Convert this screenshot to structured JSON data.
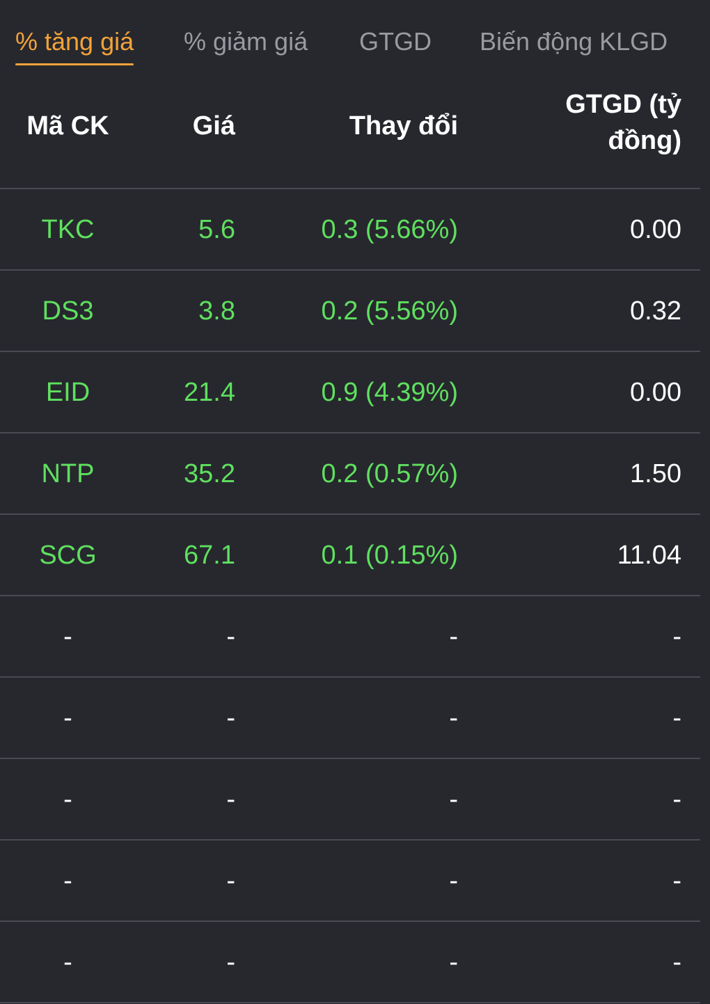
{
  "tabs": [
    {
      "label": "% tăng giá",
      "active": true
    },
    {
      "label": "% giảm giá",
      "active": false
    },
    {
      "label": "GTGD",
      "active": false
    },
    {
      "label": "Biến động KLGD",
      "active": false
    }
  ],
  "table": {
    "headers": {
      "code": "Mã CK",
      "price": "Giá",
      "change": "Thay đổi",
      "value_line1": "GTGD (tỷ",
      "value_line2": "đồng)"
    },
    "rows": [
      {
        "code": "TKC",
        "price": "5.6",
        "change": "0.3 (5.66%)",
        "value": "0.00"
      },
      {
        "code": "DS3",
        "price": "3.8",
        "change": "0.2 (5.56%)",
        "value": "0.32"
      },
      {
        "code": "EID",
        "price": "21.4",
        "change": "0.9 (4.39%)",
        "value": "0.00"
      },
      {
        "code": "NTP",
        "price": "35.2",
        "change": "0.2 (0.57%)",
        "value": "1.50"
      },
      {
        "code": "SCG",
        "price": "67.1",
        "change": "0.1 (0.15%)",
        "value": "11.04"
      },
      {
        "code": "-",
        "price": "-",
        "change": "-",
        "value": "-"
      },
      {
        "code": "-",
        "price": "-",
        "change": "-",
        "value": "-"
      },
      {
        "code": "-",
        "price": "-",
        "change": "-",
        "value": "-"
      },
      {
        "code": "-",
        "price": "-",
        "change": "-",
        "value": "-"
      },
      {
        "code": "-",
        "price": "-",
        "change": "-",
        "value": "-"
      }
    ]
  },
  "colors": {
    "background": "#27282e",
    "active_tab": "#f2a33a",
    "inactive_tab": "#9a9ba0",
    "up": "#5fe05f",
    "divider": "#4a4b52"
  }
}
